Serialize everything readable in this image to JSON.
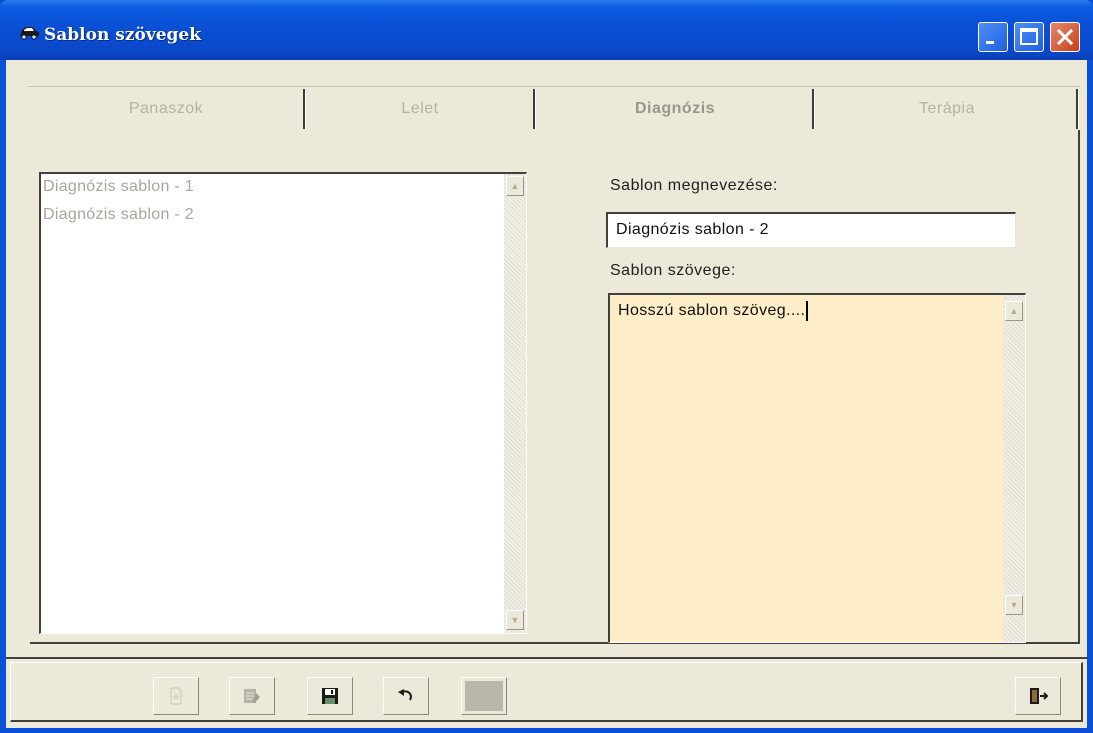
{
  "window": {
    "title": "Sablon szövegek",
    "icons": {
      "app": "car-icon",
      "minimize": "minimize-icon",
      "maximize": "maximize-icon",
      "close": "close-icon"
    }
  },
  "tabs": [
    {
      "label": "Panaszok",
      "active": false
    },
    {
      "label": "Lelet",
      "active": false
    },
    {
      "label": "Diagnózis",
      "active": true
    },
    {
      "label": "Terápia",
      "active": false
    }
  ],
  "template_list": {
    "items": [
      "Diagnózis sablon - 1",
      "Diagnózis sablon - 2"
    ]
  },
  "form": {
    "name_label": "Sablon megnevezése:",
    "name_value": "Diagnózis sablon - 2",
    "text_label": "Sablon szövege:",
    "text_value": "Hosszú sablon szöveg...."
  },
  "toolbar": {
    "buttons": [
      {
        "icon": "new-document-icon",
        "enabled": false
      },
      {
        "icon": "edit-document-icon",
        "enabled": false
      },
      {
        "icon": "save-disk-icon",
        "enabled": true
      },
      {
        "icon": "undo-icon",
        "enabled": true
      },
      {
        "icon": "blank-icon",
        "enabled": false
      },
      {
        "icon": "exit-door-icon",
        "enabled": true
      }
    ]
  },
  "colors": {
    "titlebar": "#0a4fd4",
    "client": "#ece9d8",
    "text_area_bg": "#fdeec7"
  }
}
